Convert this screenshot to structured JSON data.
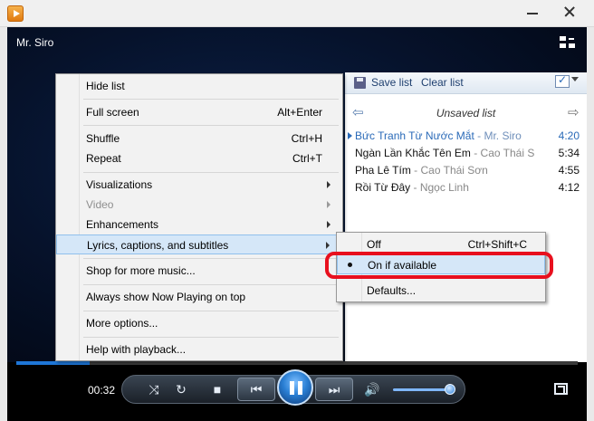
{
  "window": {
    "title": ""
  },
  "now_playing": {
    "title": "Mr. Siro",
    "time": "00:32",
    "seek_progress": 0.13,
    "volume": 0.95
  },
  "playlist": {
    "save_label": "Save list",
    "clear_label": "Clear list",
    "name": "Unsaved list",
    "items": [
      {
        "title": "Bức Tranh Từ Nước Mắt",
        "artist": " - Mr. Siro",
        "duration": "4:20",
        "active": true
      },
      {
        "title": "Ngàn Lần Khắc Tên Em",
        "artist": " - Cao Thái S",
        "duration": "5:34",
        "active": false
      },
      {
        "title": "Pha Lê Tím",
        "artist": " - Cao Thái Sơn",
        "duration": "4:55",
        "active": false
      },
      {
        "title": "Rồi Từ Đây",
        "artist": " - Ngọc Linh",
        "duration": "4:12",
        "active": false
      }
    ]
  },
  "menu": {
    "items": [
      {
        "label": "Hide list"
      },
      {
        "label": "Full screen",
        "shortcut": "Alt+Enter"
      },
      {
        "label": "Shuffle",
        "shortcut": "Ctrl+H"
      },
      {
        "label": "Repeat",
        "shortcut": "Ctrl+T"
      },
      {
        "label": "Visualizations"
      },
      {
        "label": "Video"
      },
      {
        "label": "Enhancements"
      },
      {
        "label": "Lyrics, captions, and subtitles"
      },
      {
        "label": "Shop for more music..."
      },
      {
        "label": "Always show Now Playing on top"
      },
      {
        "label": "More options..."
      },
      {
        "label": "Help with playback..."
      }
    ]
  },
  "submenu": {
    "items": [
      {
        "label": "Off",
        "shortcut": "Ctrl+Shift+C"
      },
      {
        "label": "On if available"
      },
      {
        "label": "Defaults..."
      }
    ]
  },
  "colors": {
    "accent": "#2a6ab8",
    "annotation": "#e8101e",
    "menu_highlight": "#d5e7f8"
  },
  "icons": {
    "app": "media-player-icon",
    "compact": "switch-to-library-icon",
    "save": "save-icon",
    "shuffle": "shuffle-icon",
    "repeat": "repeat-icon",
    "stop": "stop-icon",
    "previous": "previous-icon",
    "pause": "pause-icon",
    "next": "next-icon",
    "volume": "speaker-icon",
    "fullscreen": "fullscreen-icon"
  }
}
